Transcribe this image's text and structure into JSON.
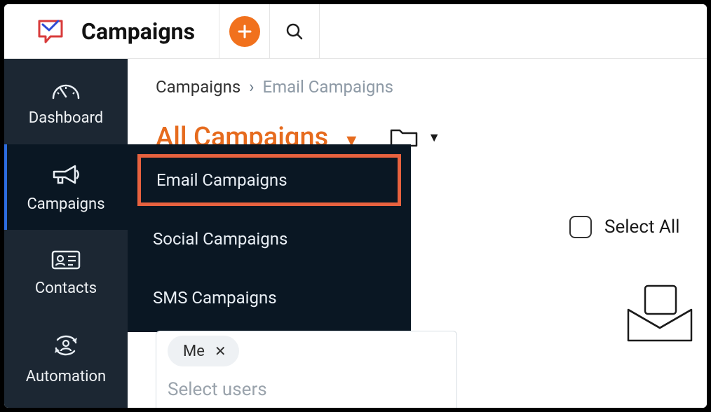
{
  "app_title": "Campaigns",
  "top": {
    "add_label": "+",
    "search_label": "Search"
  },
  "sidebar": {
    "items": [
      {
        "key": "dashboard",
        "label": "Dashboard"
      },
      {
        "key": "campaigns",
        "label": "Campaigns"
      },
      {
        "key": "contacts",
        "label": "Contacts"
      },
      {
        "key": "automation",
        "label": "Automation"
      }
    ]
  },
  "breadcrumbs": {
    "items": [
      {
        "label": "Campaigns",
        "muted": false
      },
      {
        "label": "Email Campaigns",
        "muted": true
      }
    ],
    "separator": "›"
  },
  "page_title": "All Campaigns",
  "submenu": {
    "items": [
      {
        "label": "Email Campaigns",
        "highlighted": true
      },
      {
        "label": "Social Campaigns",
        "highlighted": false
      },
      {
        "label": "SMS Campaigns",
        "highlighted": false
      }
    ]
  },
  "select_all_label": "Select All",
  "users": {
    "chip_label": "Me",
    "placeholder": "Select users"
  },
  "colors": {
    "accent_orange": "#f1711d",
    "sidebar_bg": "#1c2733",
    "sidebar_active_bg": "#0a1723",
    "active_marker": "#2d6cdf",
    "highlight_border": "#e8623f"
  }
}
